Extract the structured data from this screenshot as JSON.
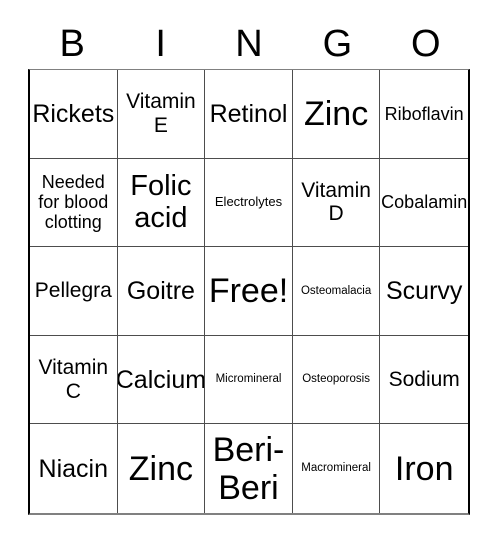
{
  "card": {
    "title": "BINGO",
    "header_letters": [
      "B",
      "I",
      "N",
      "G",
      "O"
    ],
    "free_space_label": "Free!",
    "colors": {
      "background": "#ffffff",
      "text": "#000000",
      "grid_line": "#4d4d4d",
      "outer_border": "#000000"
    },
    "rows": [
      [
        {
          "label": "Rickets",
          "size": "fs-lg"
        },
        {
          "label": "Vitamin E",
          "size": "fs-md"
        },
        {
          "label": "Retinol",
          "size": "fs-lg"
        },
        {
          "label": "Zinc",
          "size": "fs-xxl"
        },
        {
          "label": "Riboflavin",
          "size": "fs-sm"
        }
      ],
      [
        {
          "label": "Needed for blood clotting",
          "size": "fs-sm"
        },
        {
          "label": "Folic acid",
          "size": "fs-xl"
        },
        {
          "label": "Electrolytes",
          "size": "fs-xs"
        },
        {
          "label": "Vitamin D",
          "size": "fs-md"
        },
        {
          "label": "Cobalamin",
          "size": "fs-sm"
        }
      ],
      [
        {
          "label": "Pellegra",
          "size": "fs-md"
        },
        {
          "label": "Goitre",
          "size": "fs-lg"
        },
        {
          "label": "Free!",
          "size": "fs-xxl"
        },
        {
          "label": "Osteomalacia",
          "size": "fs-xxs"
        },
        {
          "label": "Scurvy",
          "size": "fs-lg"
        }
      ],
      [
        {
          "label": "Vitamin C",
          "size": "fs-md"
        },
        {
          "label": "Calcium",
          "size": "fs-lg"
        },
        {
          "label": "Micromineral",
          "size": "fs-xxs"
        },
        {
          "label": "Osteoporosis",
          "size": "fs-xxs"
        },
        {
          "label": "Sodium",
          "size": "fs-md"
        }
      ],
      [
        {
          "label": "Niacin",
          "size": "fs-lg"
        },
        {
          "label": "Zinc",
          "size": "fs-xxl"
        },
        {
          "label": "Beri-Beri",
          "size": "fs-xxl"
        },
        {
          "label": "Macromineral",
          "size": "fs-xxs"
        },
        {
          "label": "Iron",
          "size": "fs-xxl"
        }
      ]
    ]
  }
}
